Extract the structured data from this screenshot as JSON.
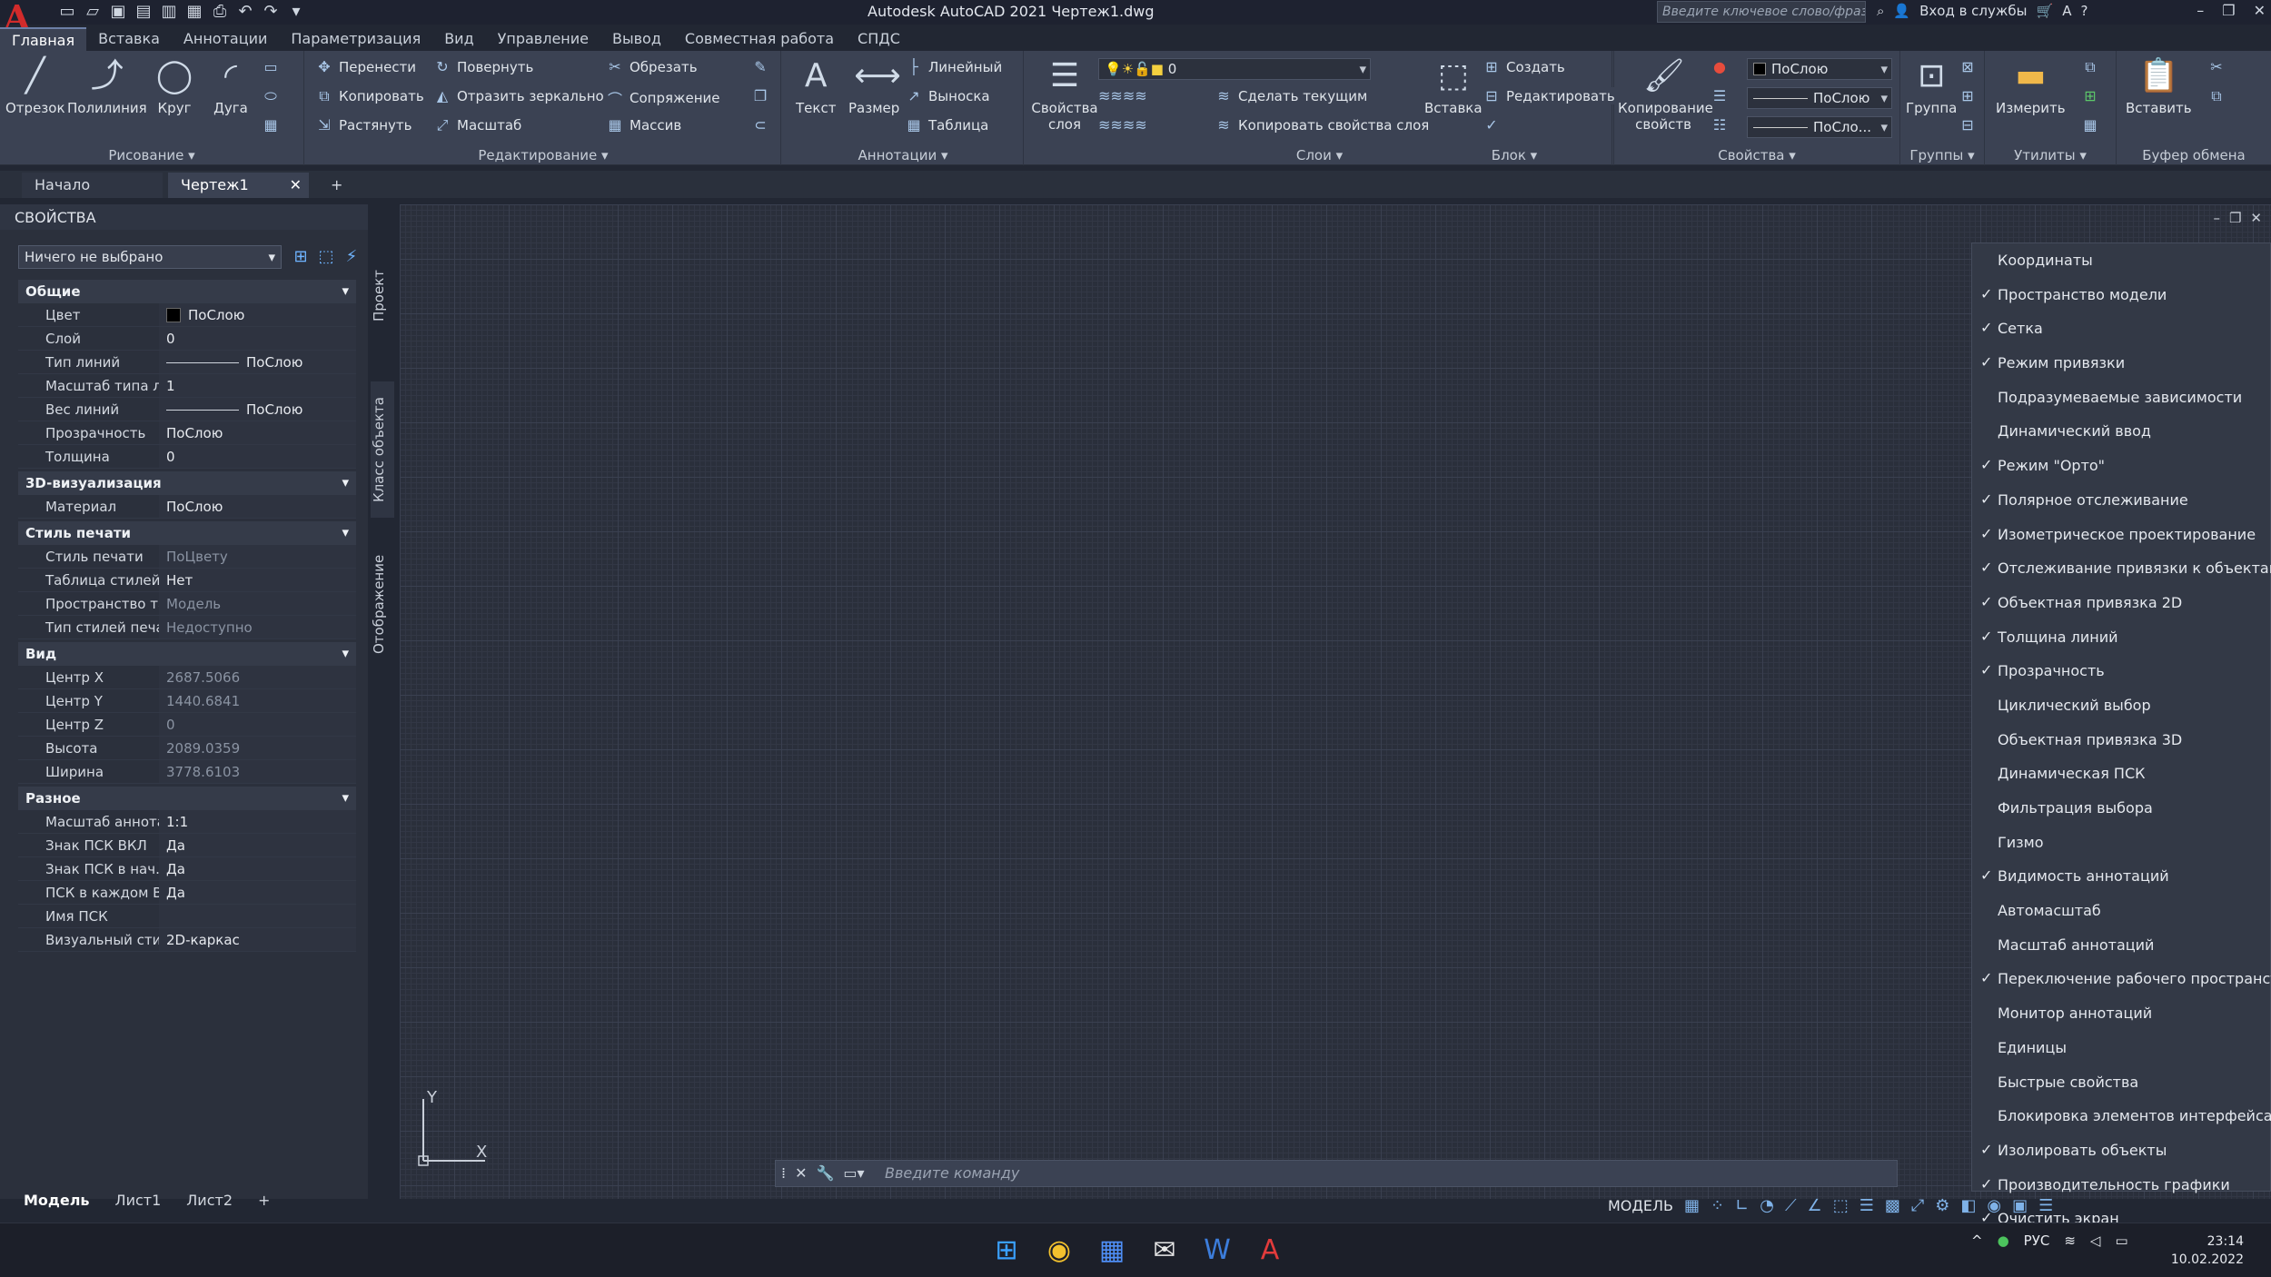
{
  "title_bar": {
    "logo": "A",
    "title": "Autodesk AutoCAD 2021   Чертеж1.dwg",
    "search_placeholder": "Введите ключевое слово/фразу",
    "sign_in": "Вход в службы"
  },
  "ribbon_tabs": [
    "Главная",
    "Вставка",
    "Аннотации",
    "Параметризация",
    "Вид",
    "Управление",
    "Вывод",
    "Совместная работа",
    "СПДС"
  ],
  "ribbon": {
    "draw": {
      "title": "Рисование ▾",
      "line": "Отрезок",
      "polyline": "Полилиния",
      "circle": "Круг",
      "arc": "Дуга"
    },
    "modify": {
      "title": "Редактирование ▾",
      "move": "Перенести",
      "rotate": "Повернуть",
      "trim": "Обрезать",
      "copy": "Копировать",
      "mirror": "Отразить зеркально",
      "fillet": "Сопряжение",
      "stretch": "Растянуть",
      "scale": "Масштаб",
      "array": "Массив"
    },
    "annotation": {
      "title": "Аннотации ▾",
      "text": "Текст",
      "dimension": "Размер",
      "linear": "Линейный",
      "leader": "Выноска",
      "table": "Таблица"
    },
    "layers": {
      "title": "Слои ▾",
      "properties": "Свойства слоя",
      "layer_value": "0",
      "make_current": "Сделать текущим",
      "match_layer": "Копировать свойства слоя"
    },
    "block": {
      "title": "Блок ▾",
      "insert": "Вставка",
      "create": "Создать",
      "edit": "Редактировать"
    },
    "properties": {
      "title": "Свойства ▾",
      "match": "Копирование свойств",
      "color": "ПоСлою",
      "lineweight": "ПоСлою",
      "linetype": "ПоСло..."
    },
    "groups": {
      "title": "Группы ▾",
      "group": "Группа"
    },
    "utilities": {
      "title": "Утилиты ▾",
      "measure": "Измерить"
    },
    "clipboard": {
      "title": "Буфер обмена",
      "paste": "Вставить"
    }
  },
  "doc_tabs": [
    "Начало",
    "Чертеж1"
  ],
  "properties_palette": {
    "title": "СВОЙСТВА",
    "selection": "Ничего не выбрано",
    "sections": [
      {
        "name": "Общие",
        "rows": [
          {
            "k": "Цвет",
            "v": "ПоСлою",
            "type": "swatch"
          },
          {
            "k": "Слой",
            "v": "0"
          },
          {
            "k": "Тип линий",
            "v": "ПоСлою",
            "type": "line"
          },
          {
            "k": "Масштаб типа лин...",
            "v": "1"
          },
          {
            "k": "Вес линий",
            "v": "ПоСлою",
            "type": "line"
          },
          {
            "k": "Прозрачность",
            "v": "ПоСлою"
          },
          {
            "k": "Толщина",
            "v": "0"
          }
        ]
      },
      {
        "name": "3D-визуализация",
        "rows": [
          {
            "k": "Материал",
            "v": "ПоСлою"
          }
        ]
      },
      {
        "name": "Стиль печати",
        "rows": [
          {
            "k": "Стиль печати",
            "v": "ПоЦвету",
            "dim": true
          },
          {
            "k": "Таблица стилей п...",
            "v": "Нет"
          },
          {
            "k": "Пространство таб...",
            "v": "Модель",
            "dim": true
          },
          {
            "k": "Тип стилей печати",
            "v": "Недоступно",
            "dim": true
          }
        ]
      },
      {
        "name": "Вид",
        "rows": [
          {
            "k": "Центр X",
            "v": "2687.5066",
            "dim": true
          },
          {
            "k": "Центр Y",
            "v": "1440.6841",
            "dim": true
          },
          {
            "k": "Центр Z",
            "v": "0",
            "dim": true
          },
          {
            "k": "Высота",
            "v": "2089.0359",
            "dim": true
          },
          {
            "k": "Ширина",
            "v": "3778.6103",
            "dim": true
          }
        ]
      },
      {
        "name": "Разное",
        "rows": [
          {
            "k": "Масштаб аннотац...",
            "v": "1:1"
          },
          {
            "k": "Знак ПСК ВКЛ",
            "v": "Да"
          },
          {
            "k": "Знак ПСК в нач. к...",
            "v": "Да"
          },
          {
            "k": "ПСК в каждом Вэк...",
            "v": "Да"
          },
          {
            "k": "Имя ПСК",
            "v": ""
          },
          {
            "k": "Визуальный стиль",
            "v": "2D-каркас"
          }
        ]
      }
    ],
    "side_tabs": [
      "Проект",
      "Класс объекта",
      "Отображение"
    ]
  },
  "context_menu": [
    {
      "label": "Координаты",
      "checked": false
    },
    {
      "label": "Пространство модели",
      "checked": true
    },
    {
      "label": "Сетка",
      "checked": true
    },
    {
      "label": "Режим привязки",
      "checked": true
    },
    {
      "label": "Подразумеваемые зависимости",
      "checked": false
    },
    {
      "label": "Динамический ввод",
      "checked": false
    },
    {
      "label": "Режим \"Орто\"",
      "checked": true
    },
    {
      "label": "Полярное отслеживание",
      "checked": true
    },
    {
      "label": "Изометрическое проектирование",
      "checked": true
    },
    {
      "label": "Отслеживание привязки к объектам",
      "checked": true
    },
    {
      "label": "Объектная привязка 2D",
      "checked": true
    },
    {
      "label": "Толщина линий",
      "checked": true
    },
    {
      "label": "Прозрачность",
      "checked": true
    },
    {
      "label": "Циклический выбор",
      "checked": false
    },
    {
      "label": "Объектная привязка 3D",
      "checked": false
    },
    {
      "label": "Динамическая ПСК",
      "checked": false
    },
    {
      "label": "Фильтрация выбора",
      "checked": false
    },
    {
      "label": "Гизмо",
      "checked": false
    },
    {
      "label": "Видимость аннотаций",
      "checked": true
    },
    {
      "label": "Автомасштаб",
      "checked": false
    },
    {
      "label": "Масштаб аннотаций",
      "checked": false
    },
    {
      "label": "Переключение рабочего пространства",
      "checked": true
    },
    {
      "label": "Монитор аннотаций",
      "checked": false
    },
    {
      "label": "Единицы",
      "checked": false
    },
    {
      "label": "Быстрые свойства",
      "checked": false
    },
    {
      "label": "Блокировка элементов интерфейса",
      "checked": false
    },
    {
      "label": "Изолировать объекты",
      "checked": true
    },
    {
      "label": "Производительность графики",
      "checked": true
    },
    {
      "label": "Очистить экран",
      "checked": true
    }
  ],
  "command_line": {
    "placeholder": "Введите команду"
  },
  "ucs": {
    "x": "X",
    "y": "Y"
  },
  "layout_tabs": [
    "Модель",
    "Лист1",
    "Лист2"
  ],
  "status_bar": {
    "mode": "МОДЕЛЬ"
  },
  "taskbar": {
    "lang": "РУС",
    "time": "23:14",
    "date": "10.02.2022"
  }
}
